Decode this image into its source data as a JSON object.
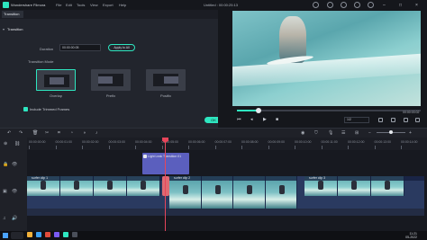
{
  "titlebar": {
    "app_name": "Wondershare Filmora",
    "menus": [
      "File",
      "Edit",
      "Tools",
      "View",
      "Export",
      "Help"
    ],
    "window_title": "Untitled : 00:00:25:13",
    "window_controls": [
      "–",
      "□",
      "×"
    ]
  },
  "panel": {
    "tab": "Transition",
    "section": "Transition",
    "duration_label": "Duration",
    "duration_value": "00:00:00:05",
    "apply_all": "Apply to All",
    "mode_label": "Transition Mode",
    "modes": [
      "Overlap",
      "Prefix",
      "Postfix"
    ],
    "selected_mode": "Overlap",
    "include_trimmed": "Include Trimmed Frames",
    "ok_button": "OK"
  },
  "preview": {
    "timecode": "00:00:03:02",
    "progress": 0.12,
    "ratio": "1/2"
  },
  "timeline": {
    "ticks": [
      "00:00:00:00",
      "00:00:01:00",
      "00:00:02:00",
      "00:00:03:00",
      "00:00:04:00",
      "00:00:05:00",
      "00:00:06:00",
      "00:00:07:00",
      "00:00:08:00",
      "00:00:09:00",
      "00:00:10:00",
      "00:00:11:00",
      "00:00:12:00",
      "00:00:13:00",
      "00:00:14:00"
    ],
    "title_clip_label": "Light Leak Transition 01",
    "clip_a_label": "surfer clip 1",
    "clip_b_label": "surfer clip 2",
    "clip_c_label": "surfer clip 3"
  },
  "taskbar": {
    "time": "11:21",
    "date": "05-2022"
  },
  "colors": {
    "accent": "#2ee6c0",
    "playhead": "#e6455a",
    "title_clip": "#5b5fbe",
    "video_track": "#2a3a60"
  }
}
